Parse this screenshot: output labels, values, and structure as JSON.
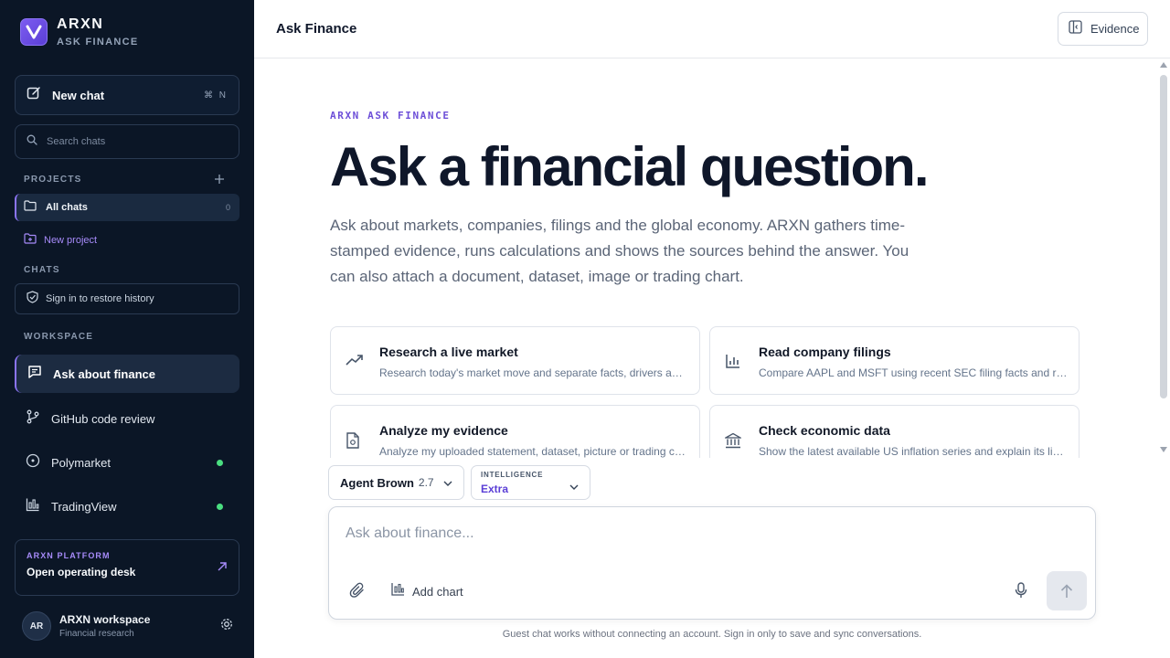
{
  "brand": {
    "name": "ARXN",
    "subtitle": "ASK FINANCE"
  },
  "sidebar": {
    "new_chat": {
      "label": "New chat",
      "shortcut": "⌘ N"
    },
    "search": {
      "placeholder": "Search chats"
    },
    "projects": {
      "heading": "PROJECTS",
      "all_chats": {
        "label": "All chats",
        "count": "0"
      },
      "new_project": "New project"
    },
    "chats": {
      "heading": "CHATS",
      "signin": "Sign in to restore history"
    },
    "workspace": {
      "heading": "WORKSPACE",
      "items": [
        {
          "label": "Ask about finance",
          "icon": "chat-icon",
          "active": true
        },
        {
          "label": "GitHub code review",
          "icon": "git-branch-icon",
          "status": "online"
        },
        {
          "label": "Polymarket",
          "icon": "target-icon",
          "status": "online"
        },
        {
          "label": "TradingView",
          "icon": "chart-icon",
          "status": "online"
        }
      ]
    },
    "platform": {
      "kicker": "ARXN PLATFORM",
      "title": "Open operating desk"
    },
    "profile": {
      "initials": "AR",
      "name": "ARXN workspace",
      "subtitle": "Financial research"
    }
  },
  "topbar": {
    "title": "Ask Finance",
    "evidence_label": "Evidence"
  },
  "hero": {
    "kicker": "ARXN ASK FINANCE",
    "headline": "Ask a financial question.",
    "subtext": "Ask about markets, companies, filings and the global economy. ARXN gathers time-stamped evidence, runs calculations and shows the sources behind the answer. You can also attach a document, dataset, image or trading chart."
  },
  "cards": [
    {
      "title": "Research a live market",
      "desc": "Research today's market move and separate facts, drivers and uncertainty",
      "icon": "trending-up-icon"
    },
    {
      "title": "Read company filings",
      "desc": "Compare AAPL and MSFT using recent SEC filing facts and risk",
      "icon": "bar-chart-icon"
    },
    {
      "title": "Analyze my evidence",
      "desc": "Analyze my uploaded statement, dataset, picture or trading chart",
      "icon": "document-icon"
    },
    {
      "title": "Check economic data",
      "desc": "Show the latest available US inflation series and explain its limits",
      "icon": "bank-icon"
    }
  ],
  "composer": {
    "model_name": "Agent Brown",
    "model_version": "2.7",
    "intelligence_label": "INTELLIGENCE",
    "intelligence_value": "Extra",
    "placeholder": "Ask about finance...",
    "add_chart": "Add chart",
    "footnote": "Guest chat works without connecting an account. Sign in only to save and sync conversations."
  },
  "colors": {
    "sidebar_bg": "#0b1626",
    "accent": "#6d4fd8",
    "status_dot": "#4ade80"
  }
}
